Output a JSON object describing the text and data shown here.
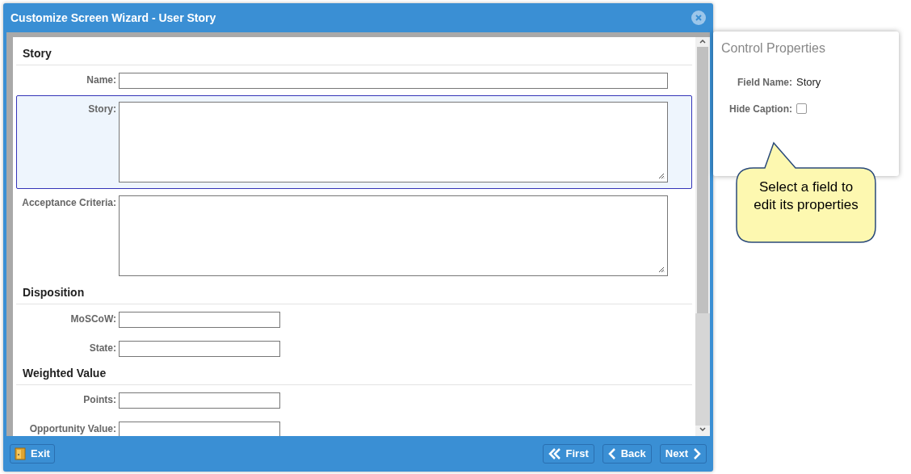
{
  "window": {
    "title": "Customize Screen Wizard - User Story"
  },
  "sections": [
    {
      "heading": "Story",
      "fields": [
        {
          "label": "Name:",
          "kind": "text",
          "selected": false
        },
        {
          "label": "Story:",
          "kind": "textarea",
          "selected": true
        },
        {
          "label": "Acceptance Criteria:",
          "kind": "textarea",
          "selected": false
        }
      ]
    },
    {
      "heading": "Disposition",
      "fields": [
        {
          "label": "MoSCoW:",
          "kind": "short",
          "selected": false
        },
        {
          "label": "State:",
          "kind": "short",
          "selected": false
        }
      ]
    },
    {
      "heading": "Weighted Value",
      "fields": [
        {
          "label": "Points:",
          "kind": "short",
          "selected": false
        },
        {
          "label": "Opportunity Value:",
          "kind": "short",
          "selected": false
        }
      ]
    }
  ],
  "footer": {
    "exit": "Exit",
    "buttons": [
      {
        "label": "First",
        "kind": "first"
      },
      {
        "label": "Back",
        "kind": "back"
      },
      {
        "label": "Next",
        "kind": "next"
      }
    ]
  },
  "properties": {
    "title": "Control Properties",
    "field_name_label": "Field Name:",
    "field_name": "Story",
    "hide_caption_label": "Hide Caption:",
    "hide_caption": false
  },
  "callout": "Select a field to edit its properties"
}
